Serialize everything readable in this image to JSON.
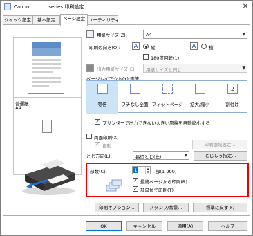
{
  "window": {
    "title": "Canon　　　　series 印刷設定",
    "close_glyph": "✕"
  },
  "tabs": [
    "クイック設定",
    "基本設定",
    "ページ設定",
    "ユーティリティ"
  ],
  "preview": {
    "media_name": "普通紙",
    "media_size": "A4"
  },
  "paper_size": {
    "label": "用紙サイズ(Z):",
    "value": "A4"
  },
  "orientation": {
    "label": "印刷の向き(O):",
    "portrait": "縦",
    "landscape": "横",
    "selected": "portrait",
    "rotate180": "180度回転(1)"
  },
  "output_size": {
    "label": "出力用紙サイズ(E):",
    "value": "用紙サイズと同じ"
  },
  "page_layout": {
    "label": "ページレイアウト(Y):等倍",
    "options": [
      "等倍",
      "フチなし全面",
      "フィットページ",
      "拡大/縮小",
      "割付け"
    ],
    "selected": 0
  },
  "auto_reduce": {
    "label": "プリンターで出力できない大きい原稿を自動縮小する",
    "checked": true
  },
  "duplex": {
    "label": "両面印刷(X)",
    "checked": false,
    "auto_label": "自動",
    "auto_checked": true,
    "area_button": "印刷領域設定..."
  },
  "binding": {
    "label": "とじ方向(L):",
    "value": "長辺とじ(左)",
    "margin_button": "とじしろ指定..."
  },
  "copies": {
    "label": "部数(C):",
    "value": "1",
    "range": "部(1-999)",
    "last_page_first": "最終ページから印刷(R)",
    "last_page_first_checked": true,
    "collate": "部単位で印刷(T)",
    "collate_checked": true
  },
  "bottom_buttons": {
    "print_options": "印刷オプション...",
    "stamp": "スタンプ/背景...",
    "defaults": "標準に戻す(F)"
  },
  "dialog_buttons": {
    "ok": "OK",
    "cancel": "キャンセル",
    "apply": "適用(A)",
    "help": "ヘルプ"
  },
  "colors": {
    "highlight_box": "#e00000",
    "selection": "#0078d7"
  }
}
